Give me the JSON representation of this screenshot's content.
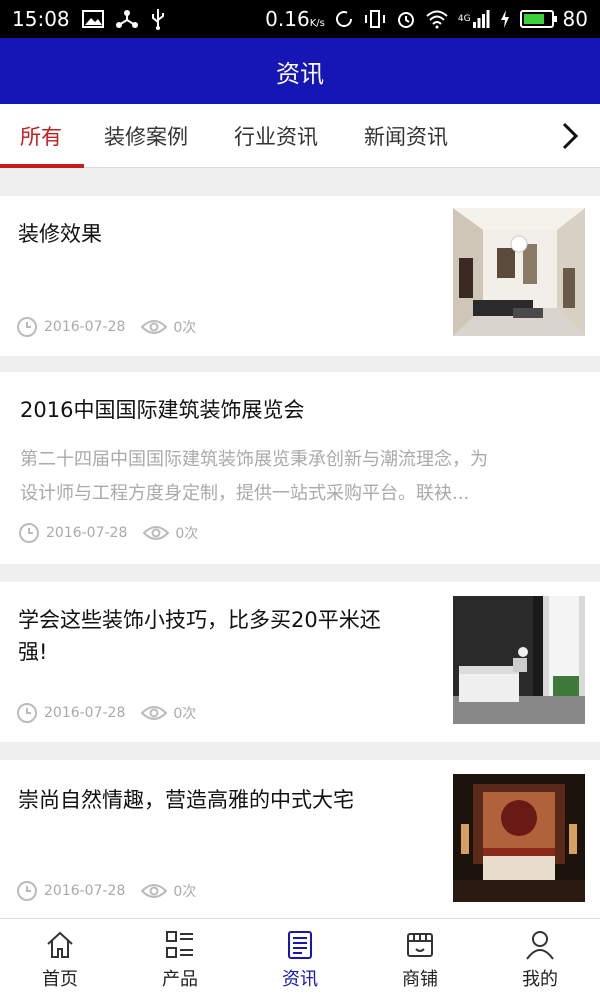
{
  "status_bar": {
    "time": "15:08",
    "speed": "0.16",
    "speed_unit": "K/s",
    "network": "4G",
    "battery": "80",
    "battery_level": 0.8
  },
  "app_bar": {
    "title": "资讯"
  },
  "tabs": [
    {
      "label": "所有",
      "active": true
    },
    {
      "label": "装修案例",
      "active": false
    },
    {
      "label": "行业资讯",
      "active": false
    },
    {
      "label": "新闻资讯",
      "active": false
    }
  ],
  "news": [
    {
      "title": "装修效果",
      "date": "2016-07-28",
      "views": "0次",
      "thumbnail": "living-room"
    },
    {
      "title": "2016中国国际建筑装饰展览会",
      "summary_line1": "第二十四届中国国际建筑装饰展览秉承创新与潮流理念，为",
      "summary_line2": "设计师与工程方度身定制，提供一站式采购平台。联袂...",
      "date": "2016-07-28",
      "views": "0次"
    },
    {
      "title_line1": "学会这些装饰小技巧，比多买20平米还",
      "title_line2": "强!",
      "date": "2016-07-28",
      "views": "0次",
      "thumbnail": "bedroom-dark"
    },
    {
      "title": "崇尚自然情趣，营造高雅的中式大宅",
      "date": "2016-07-28",
      "views": "0次",
      "thumbnail": "chinese-bedroom"
    }
  ],
  "bottom_nav": [
    {
      "label": "首页",
      "icon": "home-icon",
      "active": false
    },
    {
      "label": "产品",
      "icon": "grid-list-icon",
      "active": false
    },
    {
      "label": "资讯",
      "icon": "news-icon",
      "active": true
    },
    {
      "label": "商铺",
      "icon": "shop-icon",
      "active": false
    },
    {
      "label": "我的",
      "icon": "user-icon",
      "active": false
    }
  ],
  "colors": {
    "primary": "#1616b4",
    "accent": "#c81c1c",
    "meta_text": "#aaaaaa"
  }
}
